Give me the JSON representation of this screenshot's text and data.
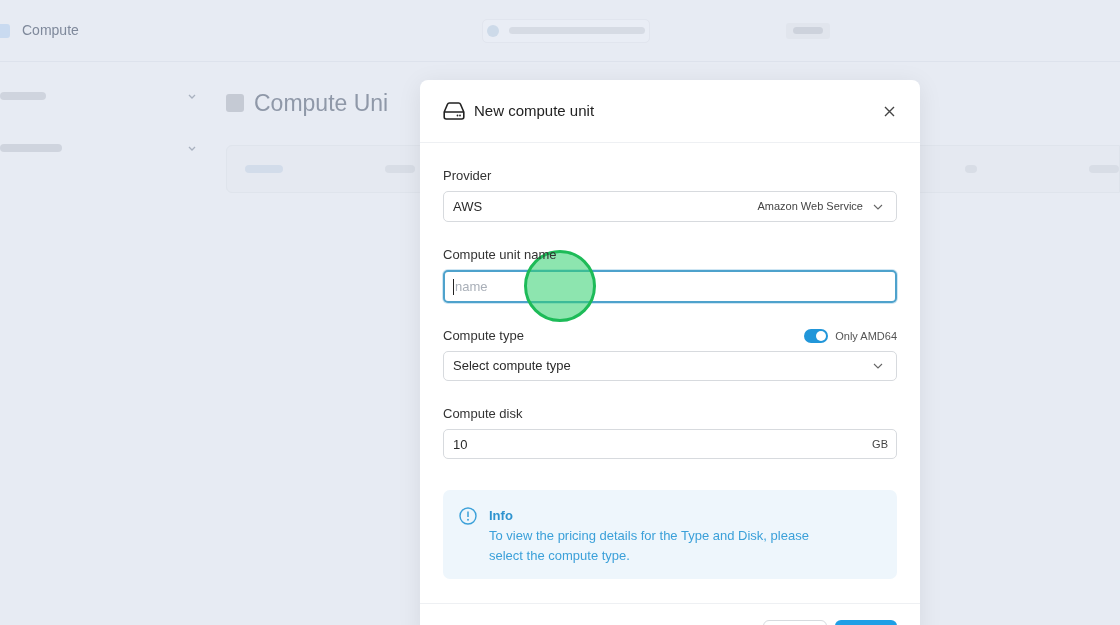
{
  "background": {
    "app_title": "Compute",
    "page_title": "Compute Uni"
  },
  "dialog": {
    "title": "New compute unit",
    "fields": [
      {
        "kind": "select",
        "label": "Provider",
        "value": "AWS",
        "hint": "Amazon Web Service"
      },
      {
        "kind": "text",
        "label": "Compute unit name",
        "placeholder": "name",
        "focused": true
      },
      {
        "kind": "select",
        "label": "Compute type",
        "placeholder": "Select compute type",
        "toggle": {
          "label": "Only AMD64",
          "on": true
        }
      },
      {
        "kind": "number",
        "label": "Compute disk",
        "value": "10",
        "suffix": "GB"
      }
    ],
    "info": {
      "title": "Info",
      "text": "To view the pricing details for the Type and Disk, please select the compute type."
    },
    "footer_buttons": [
      {
        "kind": "secondary"
      },
      {
        "kind": "primary"
      }
    ]
  }
}
